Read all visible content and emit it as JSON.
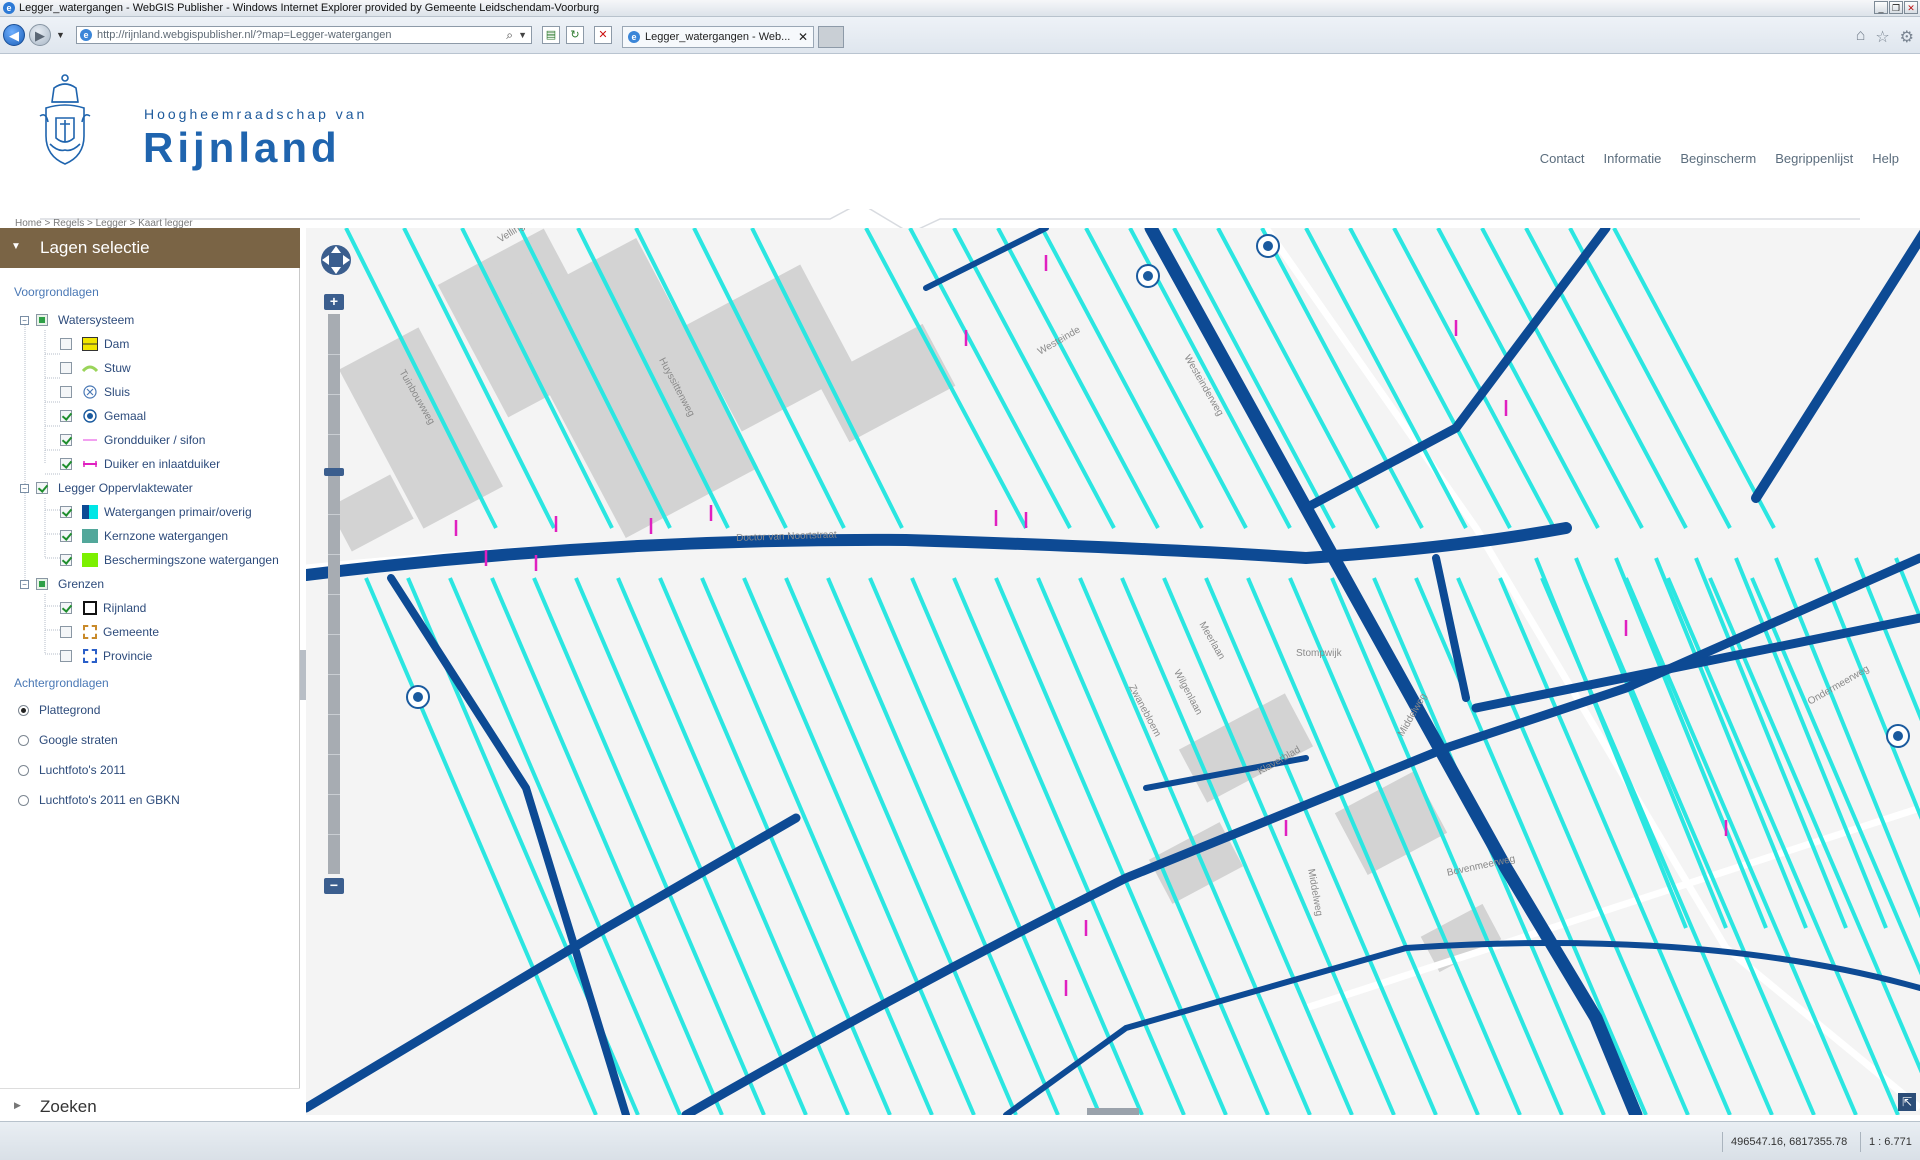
{
  "window": {
    "title": "Legger_watergangen - WebGIS Publisher - Windows Internet Explorer provided by Gemeente Leidschendam-Voorburg"
  },
  "browser": {
    "url": "http://rijnland.webgispublisher.nl/?map=Legger-watergangen",
    "tab_label": "Legger_watergangen - Web...",
    "tab_close": "✕"
  },
  "site": {
    "logo_small": "Hoogheemraadschap van",
    "logo_big": "Rijnland",
    "nav": [
      "Contact",
      "Informatie",
      "Beginscherm",
      "Begrippenlijst",
      "Help"
    ],
    "breadcrumb": "Home > Regels > Legger > Kaart legger"
  },
  "panel": {
    "header": "Lagen selectie",
    "foreground_title": "Voorgrondlagen",
    "groups": [
      {
        "label": "Watersysteem",
        "items": [
          {
            "label": "Dam",
            "checked": false,
            "icon": "dam-icon",
            "color": "#f2e600"
          },
          {
            "label": "Stuw",
            "checked": false,
            "icon": "stuw-icon",
            "color": "#9ad45a"
          },
          {
            "label": "Sluis",
            "checked": false,
            "icon": "sluis-icon",
            "color": "#4a78b5"
          },
          {
            "label": "Gemaal",
            "checked": true,
            "icon": "gemaal-icon",
            "color": "#1a5a9e"
          },
          {
            "label": "Grondduiker / sifon",
            "checked": true,
            "icon": "grondduiker-icon",
            "color": "#f2a0f0"
          },
          {
            "label": "Duiker en inlaatduiker",
            "checked": true,
            "icon": "duiker-icon",
            "color": "#e020c0"
          }
        ]
      },
      {
        "label": "Legger Oppervlaktewater",
        "items": [
          {
            "label": "Watergangen primair/overig",
            "checked": true,
            "icon": "watergangen-icon",
            "color": "#00e6e6"
          },
          {
            "label": "Kernzone watergangen",
            "checked": true,
            "icon": "kernzone-icon",
            "color": "#52a79a"
          },
          {
            "label": "Beschermingszone watergangen",
            "checked": true,
            "icon": "beschermingszone-icon",
            "color": "#7cf000"
          }
        ]
      },
      {
        "label": "Grenzen",
        "items": [
          {
            "label": "Rijnland",
            "checked": true,
            "icon": "rijnland-border-icon",
            "color": "#111111"
          },
          {
            "label": "Gemeente",
            "checked": false,
            "icon": "gemeente-border-icon",
            "color": "#c98a2a"
          },
          {
            "label": "Provincie",
            "checked": false,
            "icon": "provincie-border-icon",
            "color": "#2a5fc9"
          }
        ]
      }
    ],
    "background_title": "Achtergrondlagen",
    "background_layers": [
      {
        "label": "Plattegrond",
        "selected": true
      },
      {
        "label": "Google straten",
        "selected": false
      },
      {
        "label": "Luchtfoto's 2011",
        "selected": false
      },
      {
        "label": "Luchtfoto's 2011 en GBKN",
        "selected": false
      }
    ],
    "search_label": "Zoeken"
  },
  "map": {
    "street_labels": [
      "Vellingweg",
      "Tuinbouwweg",
      "Huyssittenweg",
      "Westeinde",
      "Westeinderweg",
      "Doctor van Noortstraat",
      "Meerlaan",
      "Stompwijk",
      "Wilgenlaan",
      "Zwanebloem",
      "Klaverblad",
      "Middelweg",
      "Bovenmeerweg",
      "Ondermeerweg",
      "Middelweg"
    ],
    "colors": {
      "primary_water": "#0d4a94",
      "secondary_water": "#2be6e1",
      "culvert": "#e020c0",
      "buildings": "#d0d0d0",
      "background": "#f4f4f4"
    }
  },
  "status": {
    "coords": "496547.16, 6817355.78",
    "scale": "1 : 6.771"
  }
}
